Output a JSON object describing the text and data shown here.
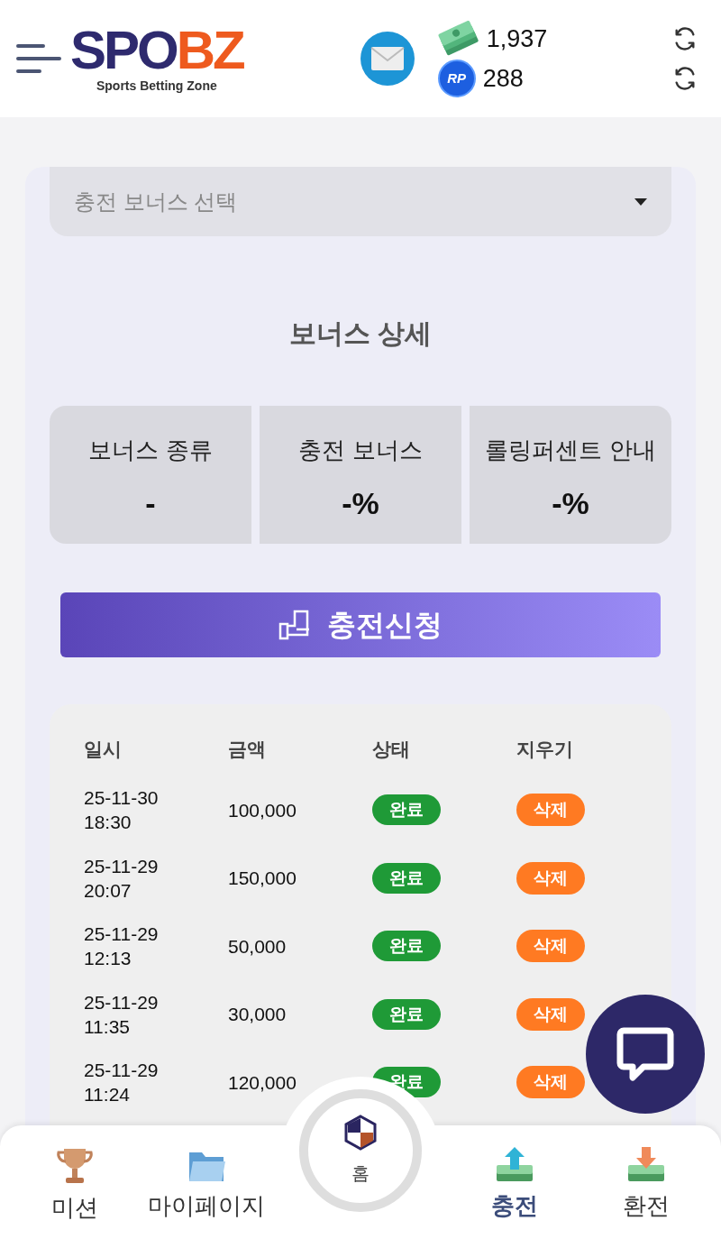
{
  "header": {
    "logo": {
      "primary": "SPO",
      "accent": "BZ",
      "tagline": "Sports Betting Zone"
    },
    "balances": [
      {
        "kind": "cash",
        "amount": "1,937"
      },
      {
        "kind": "points",
        "badge": "RP",
        "amount": "288"
      }
    ]
  },
  "bonus_select": {
    "placeholder": "충전 보너스 선택"
  },
  "bonus_detail": {
    "title": "보너스 상세",
    "cards": [
      {
        "label": "보너스 종류",
        "value": "-"
      },
      {
        "label": "충전 보너스",
        "value": "-%"
      },
      {
        "label": "롤링퍼센트 안내",
        "value": "-%"
      }
    ]
  },
  "apply_button": "충전신청",
  "history": {
    "columns": [
      "일시",
      "금액",
      "상태",
      "지우기"
    ],
    "rows": [
      {
        "date": "25-11-30",
        "time": "18:30",
        "amount": "100,000",
        "status": "완료",
        "action": "삭제"
      },
      {
        "date": "25-11-29",
        "time": "20:07",
        "amount": "150,000",
        "status": "완료",
        "action": "삭제"
      },
      {
        "date": "25-11-29",
        "time": "12:13",
        "amount": "50,000",
        "status": "완료",
        "action": "삭제"
      },
      {
        "date": "25-11-29",
        "time": "11:35",
        "amount": "30,000",
        "status": "완료",
        "action": "삭제"
      },
      {
        "date": "25-11-29",
        "time": "11:24",
        "amount": "120,000",
        "status": "완료",
        "action": "삭제"
      }
    ]
  },
  "bottom_nav": [
    {
      "kind": "trophy",
      "label": "미션",
      "selected": false
    },
    {
      "kind": "folder",
      "label": "마이페이지",
      "selected": false
    },
    {
      "kind": "home",
      "label": "홈",
      "selected": false
    },
    {
      "kind": "deposit",
      "label": "충전",
      "selected": true
    },
    {
      "kind": "withdraw",
      "label": "환전",
      "selected": false
    }
  ]
}
